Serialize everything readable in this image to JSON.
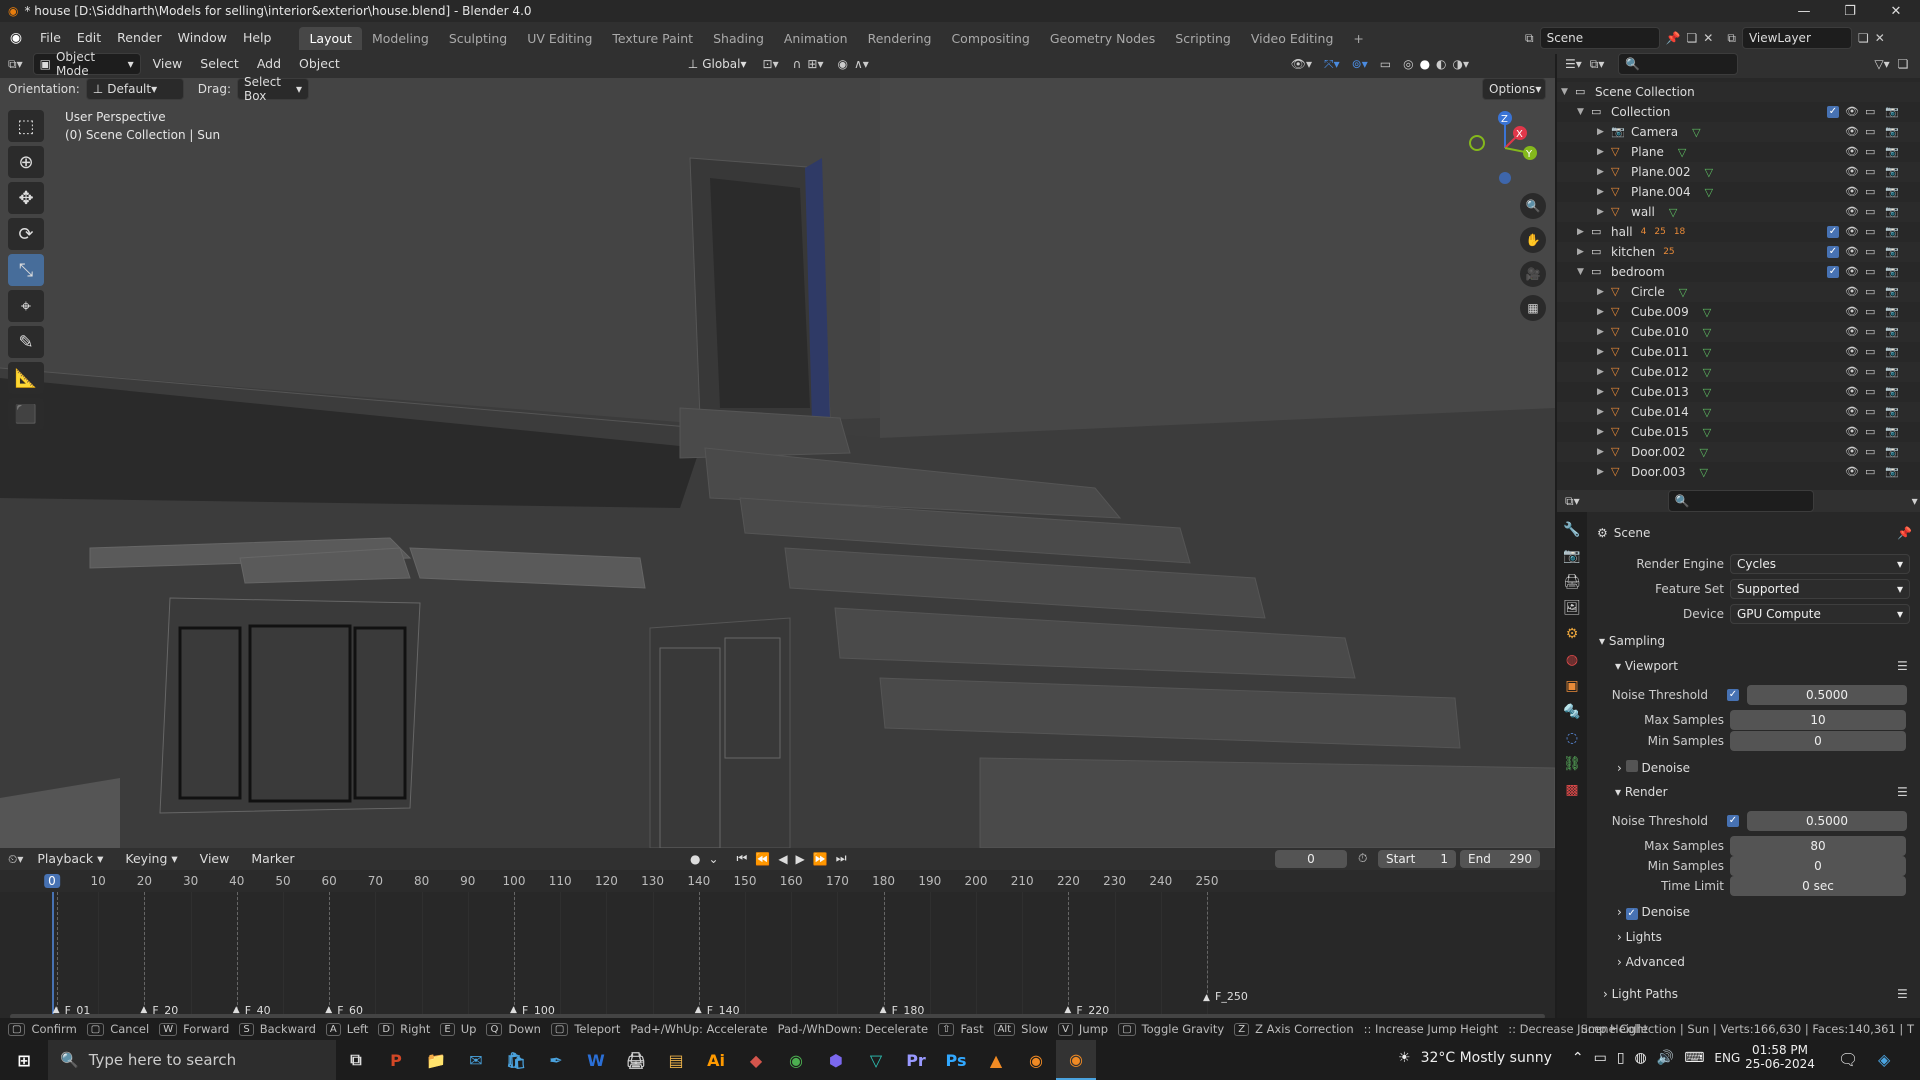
{
  "window": {
    "title": "* house [D:\\Siddharth\\Models for selling\\interior&exterior\\house.blend] - Blender 4.0"
  },
  "menus": [
    "File",
    "Edit",
    "Render",
    "Window",
    "Help"
  ],
  "workspaces": [
    "Layout",
    "Modeling",
    "Sculpting",
    "UV Editing",
    "Texture Paint",
    "Shading",
    "Animation",
    "Rendering",
    "Compositing",
    "Geometry Nodes",
    "Scripting",
    "Video Editing"
  ],
  "active_workspace": "Layout",
  "scene_name": "Scene",
  "view_layer": "ViewLayer",
  "viewport_header": {
    "mode": "Object Mode",
    "menus": [
      "View",
      "Select",
      "Add",
      "Object"
    ],
    "transform_orientation": "Global",
    "orientation_label": "Orientation:",
    "orientation_value": "Default",
    "drag_label": "Drag:",
    "drag_value": "Select Box",
    "options": "Options"
  },
  "viewport": {
    "perspective": "User Perspective",
    "collection_info": "(0) Scene Collection | Sun"
  },
  "outliner": {
    "root": "Scene Collection",
    "items": [
      {
        "name": "Collection",
        "type": "collection"
      },
      {
        "name": "Camera",
        "type": "camera"
      },
      {
        "name": "Plane",
        "type": "mesh"
      },
      {
        "name": "Plane.002",
        "type": "mesh"
      },
      {
        "name": "Plane.004",
        "type": "mesh"
      },
      {
        "name": "wall",
        "type": "mesh"
      },
      {
        "name": "hall",
        "type": "collection"
      },
      {
        "name": "kitchen",
        "type": "collection"
      },
      {
        "name": "bedroom",
        "type": "collection"
      },
      {
        "name": "Circle",
        "type": "mesh"
      },
      {
        "name": "Cube.009",
        "type": "mesh"
      },
      {
        "name": "Cube.010",
        "type": "mesh"
      },
      {
        "name": "Cube.011",
        "type": "mesh"
      },
      {
        "name": "Cube.012",
        "type": "mesh"
      },
      {
        "name": "Cube.013",
        "type": "mesh"
      },
      {
        "name": "Cube.014",
        "type": "mesh"
      },
      {
        "name": "Cube.015",
        "type": "mesh"
      },
      {
        "name": "Door.002",
        "type": "mesh"
      },
      {
        "name": "Door.003",
        "type": "mesh"
      }
    ],
    "hall_badges": [
      "4",
      "25",
      "18"
    ],
    "kitchen_badges": [
      "25"
    ]
  },
  "properties": {
    "context": "Scene",
    "render_engine_label": "Render Engine",
    "render_engine": "Cycles",
    "feature_set_label": "Feature Set",
    "feature_set": "Supported",
    "device_label": "Device",
    "device": "GPU Compute",
    "sampling": "Sampling",
    "viewport_section": "Viewport",
    "noise_threshold_label": "Noise Threshold",
    "viewport_noise_threshold": "0.5000",
    "max_samples_label": "Max Samples",
    "viewport_max_samples": "10",
    "min_samples_label": "Min Samples",
    "viewport_min_samples": "0",
    "denoise_label": "Denoise",
    "render_section": "Render",
    "render_noise_threshold": "0.5000",
    "render_max_samples": "80",
    "render_min_samples": "0",
    "time_limit_label": "Time Limit",
    "time_limit": "0 sec",
    "lights": "Lights",
    "advanced": "Advanced",
    "light_paths": "Light Paths"
  },
  "timeline": {
    "menus": [
      "Playback",
      "Keying",
      "View",
      "Marker"
    ],
    "current_frame": "0",
    "start_label": "Start",
    "start": "1",
    "end_label": "End",
    "end": "290",
    "ruler": [
      "0",
      "10",
      "20",
      "30",
      "40",
      "50",
      "60",
      "70",
      "80",
      "90",
      "100",
      "110",
      "120",
      "130",
      "140",
      "150",
      "160",
      "170",
      "180",
      "190",
      "200",
      "210",
      "220",
      "230",
      "240",
      "250"
    ],
    "markers": [
      {
        "label": "F_01",
        "frame": 1
      },
      {
        "label": "F_20",
        "frame": 20
      },
      {
        "label": "F_40",
        "frame": 40
      },
      {
        "label": "F_60",
        "frame": 60
      },
      {
        "label": "F_100",
        "frame": 100
      },
      {
        "label": "F_140",
        "frame": 140
      },
      {
        "label": "F_180",
        "frame": 180
      },
      {
        "label": "F_220",
        "frame": 220
      },
      {
        "label": "F_250",
        "frame": 250
      }
    ]
  },
  "statusbar": {
    "hints": [
      "Confirm",
      "Cancel",
      "Forward",
      "Backward",
      "Left",
      "Right",
      "Up",
      "Down",
      "Teleport",
      "Pad+/WhUp: Accelerate",
      "Pad-/WhDown: Decelerate",
      "Fast",
      "Slow",
      "Jump",
      "Toggle Gravity",
      "Z Axis Correction",
      ":: Increase Jump Height",
      ":: Decrease Jump Height"
    ],
    "keys": [
      "",
      "",
      "W",
      "S",
      "A",
      "D",
      "E",
      "Q",
      "",
      "",
      "",
      "⇧",
      "Alt",
      "V",
      "",
      "Z",
      "",
      ""
    ],
    "stats": "Scene Collection | Sun | Verts:166,630 | Faces:140,361 | T"
  },
  "taskbar": {
    "search_placeholder": "Type here to search",
    "weather": "32°C  Mostly sunny",
    "lang": "ENG",
    "time": "01:58 PM",
    "date": "25-06-2024",
    "apps": [
      "P",
      "📁",
      "✉",
      "🛍",
      "W",
      "🖨",
      "Ai",
      "Ps",
      "Pr"
    ]
  },
  "colors": {
    "accent": "#4772b3",
    "active_tool": "#476d9a",
    "timeline_cursor": "#4772b3",
    "mesh_icon": "#e88a38",
    "data_icon": "#5fbf63"
  }
}
